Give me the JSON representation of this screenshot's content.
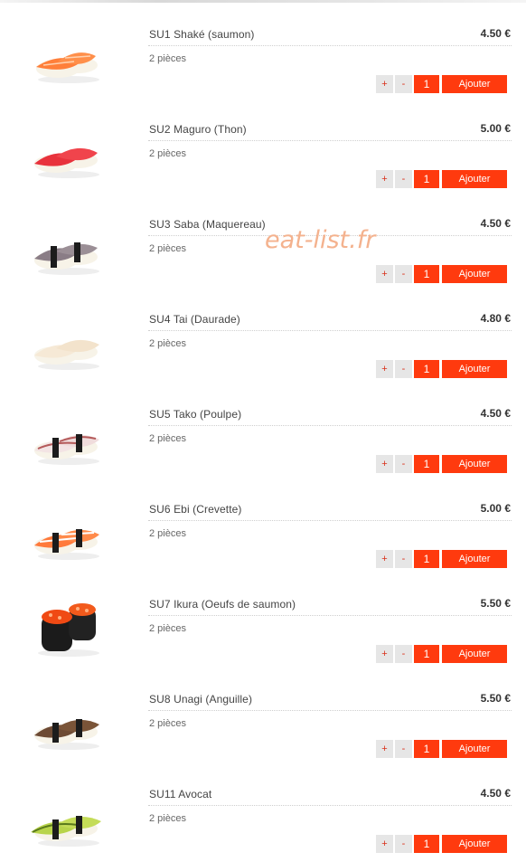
{
  "watermark": "eat-list.fr",
  "colors": {
    "accent": "#ff3a0e",
    "button_bg": "#e6e6e6"
  },
  "controls": {
    "plus": "+",
    "minus": "-",
    "qty": "1",
    "add_label": "Ajouter"
  },
  "items": [
    {
      "name": "SU1 Shaké (saumon)",
      "price": "4.50 €",
      "desc": "2 pièces",
      "icon": "salmon-sushi-icon"
    },
    {
      "name": "SU2 Maguro (Thon)",
      "price": "5.00 €",
      "desc": "2 pièces",
      "icon": "tuna-sushi-icon"
    },
    {
      "name": "SU3 Saba (Maquereau)",
      "price": "4.50 €",
      "desc": "2 pièces",
      "icon": "mackerel-sushi-icon"
    },
    {
      "name": "SU4 Tai (Daurade)",
      "price": "4.80 €",
      "desc": "2 pièces",
      "icon": "sea-bream-sushi-icon"
    },
    {
      "name": "SU5 Tako (Poulpe)",
      "price": "4.50 €",
      "desc": "2 pièces",
      "icon": "octopus-sushi-icon"
    },
    {
      "name": "SU6 Ebi (Crevette)",
      "price": "5.00 €",
      "desc": "2 pièces",
      "icon": "shrimp-sushi-icon"
    },
    {
      "name": "SU7 Ikura (Oeufs de saumon)",
      "price": "5.50 €",
      "desc": "2 pièces",
      "icon": "salmon-roe-sushi-icon"
    },
    {
      "name": "SU8 Unagi (Anguille)",
      "price": "5.50 €",
      "desc": "2 pièces",
      "icon": "eel-sushi-icon"
    },
    {
      "name": "SU11 Avocat",
      "price": "4.50 €",
      "desc": "2 pièces",
      "icon": "avocado-sushi-icon"
    }
  ]
}
